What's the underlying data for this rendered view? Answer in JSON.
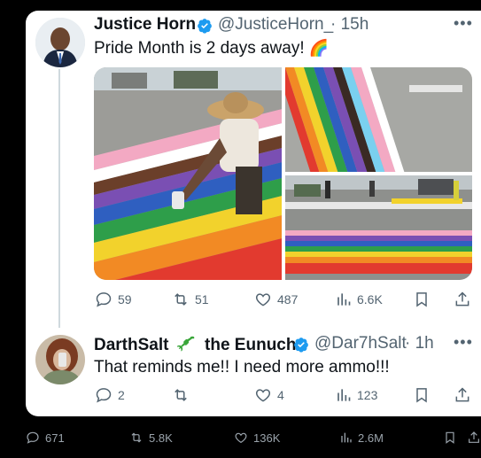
{
  "colors": {
    "background": "#000000",
    "card": "#ffffff",
    "text": "#0f1419",
    "muted": "#536471",
    "verified": "#1d9bf0"
  },
  "tweet1": {
    "display_name": "Justice Horn",
    "handle": "@JusticeHorn_",
    "time": "· 15h",
    "text": "Pride Month is 2 days away!",
    "emoji": "🌈",
    "actions": {
      "replies": "59",
      "retweets": "51",
      "likes": "487",
      "views": "6.6K"
    }
  },
  "tweet2": {
    "display_name": "DarthSalt",
    "name_emoji": "lizard",
    "name_suffix": "the Eunuch",
    "handle": "@Dar7hSalt",
    "time": "· 1h",
    "text": "That reminds me!!  I need more ammo!!!",
    "actions": {
      "replies": "2",
      "retweets": "",
      "likes": "4",
      "views": "123"
    }
  },
  "outer_actions": {
    "replies": "671",
    "retweets": "5.8K",
    "likes": "136K",
    "views": "2.6M"
  },
  "icons": [
    "verified-badge-icon",
    "more-icon",
    "reply-icon",
    "retweet-icon",
    "like-icon",
    "views-icon",
    "bookmark-icon",
    "share-icon",
    "lizard-icon",
    "rainbow-icon"
  ]
}
